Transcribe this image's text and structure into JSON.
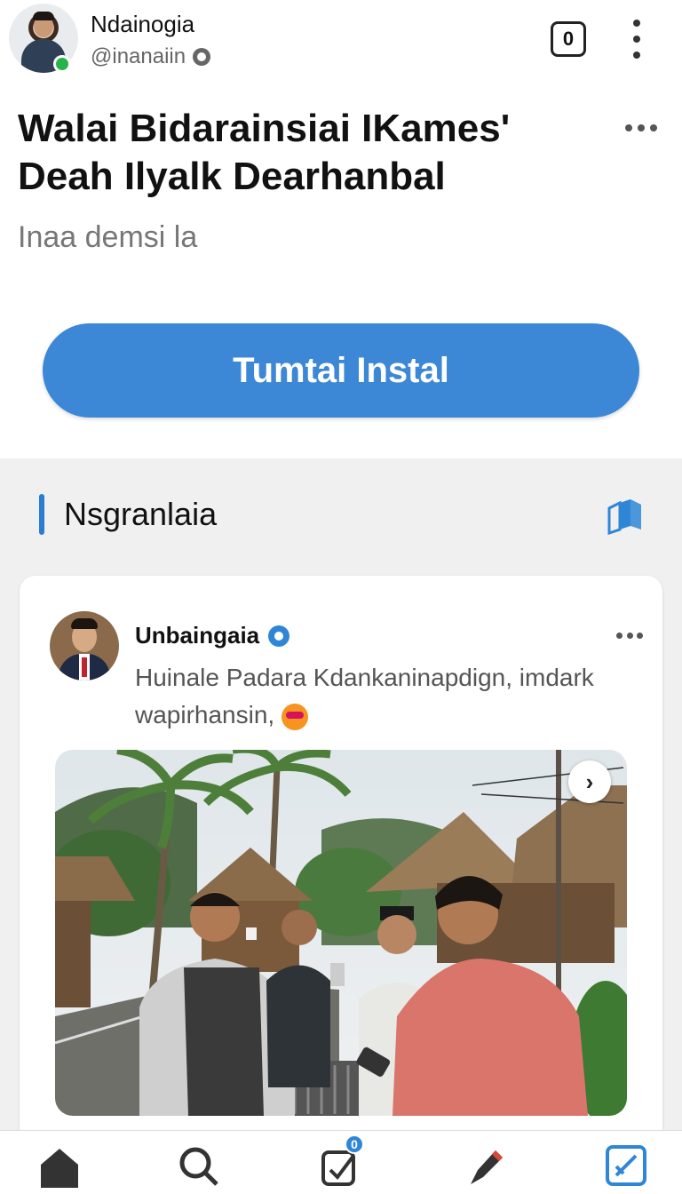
{
  "header": {
    "account_name": "Ndainogia",
    "account_handle": "@inanaiin",
    "box_icon_label": "0"
  },
  "post_header": {
    "title_line1": "Walai Bidarainsiai IKames'",
    "title_line2": "Deah Ilyalk Dearhanbal",
    "subtitle": "Inaa demsi la"
  },
  "install_button": {
    "label": "Tumtai Instal"
  },
  "section": {
    "title": "Nsgranlaia"
  },
  "card": {
    "poster_name": "Unbaingaia",
    "post_text": "Huinale Padara Kdankaninapdign, imdark wapirhansin,",
    "image_alt": "Group of men using smartphones in a tropical village with thatched huts and coconut palms"
  },
  "bottom_nav": {
    "items": [
      {
        "icon": "home-icon"
      },
      {
        "icon": "search-icon"
      },
      {
        "icon": "compose-icon",
        "badge": "0"
      },
      {
        "icon": "pen-icon"
      },
      {
        "icon": "edit-square-icon"
      }
    ]
  },
  "colors": {
    "accent": "#3c87d6",
    "section_bar": "#2b7cd3",
    "background_section": "#f0f0f0"
  }
}
